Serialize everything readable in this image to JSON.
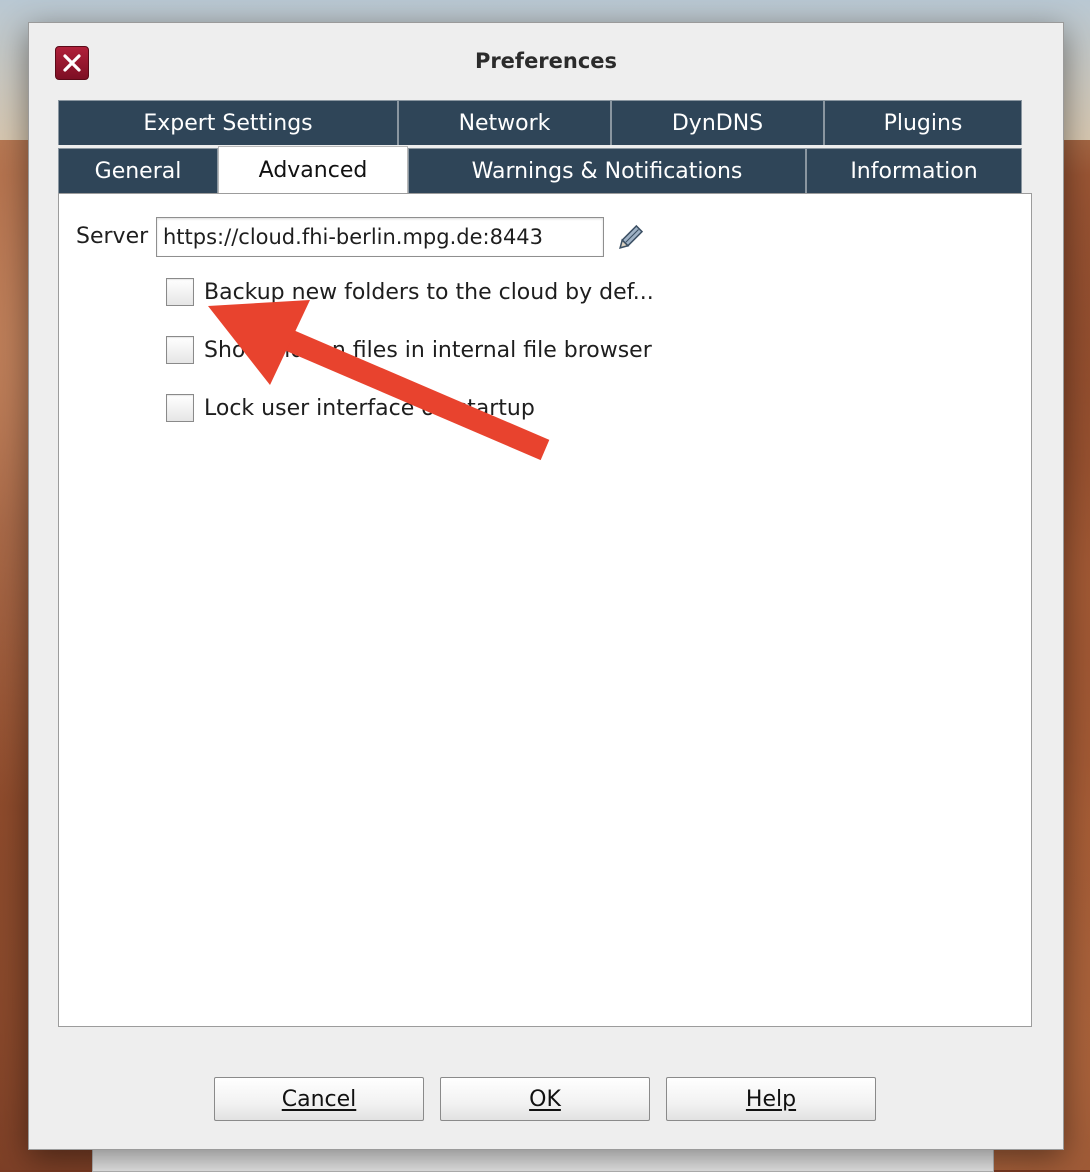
{
  "window": {
    "title": "Preferences"
  },
  "tabs_row1": [
    {
      "label": "Expert Settings"
    },
    {
      "label": "Network"
    },
    {
      "label": "DynDNS"
    },
    {
      "label": "Plugins"
    }
  ],
  "tabs_row2": [
    {
      "label": "General"
    },
    {
      "label": "Advanced",
      "active": true
    },
    {
      "label": "Warnings & Notifications"
    },
    {
      "label": "Information"
    }
  ],
  "server": {
    "label": "Server",
    "value": "https://cloud.fhi-berlin.mpg.de:8443"
  },
  "options": [
    {
      "label": "Backup new folders to the cloud by def...",
      "checked": false
    },
    {
      "label": "Show hidden files in internal file browser",
      "checked": false
    },
    {
      "label": "Lock user interface on startup",
      "checked": false
    }
  ],
  "buttons": {
    "cancel": "Cancel",
    "ok": "OK",
    "help": "Help"
  },
  "colors": {
    "tab_bg": "#2f4558",
    "close_button": "#9c1a30",
    "annotation_arrow": "#e8432e"
  },
  "icons": {
    "close": "close-x-icon",
    "edit": "pencil-edit-icon"
  }
}
